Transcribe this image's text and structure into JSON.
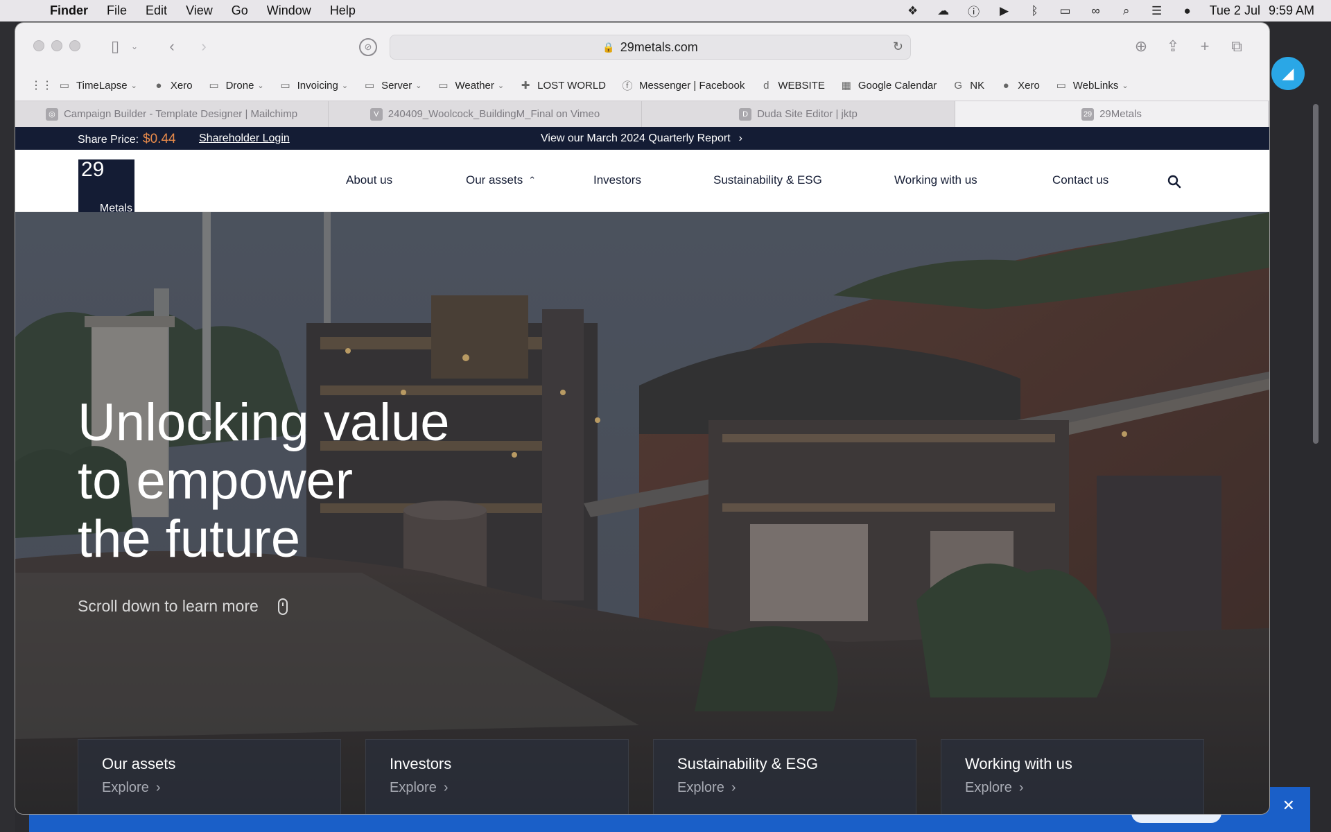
{
  "menubar": {
    "app": "Finder",
    "items": [
      "File",
      "Edit",
      "View",
      "Go",
      "Window",
      "Help"
    ],
    "date": "Tue 2 Jul",
    "time": "9:59 AM",
    "icons": [
      "dropbox-icon",
      "creative-cloud-icon",
      "onepassword-icon",
      "play-icon",
      "bluetooth-icon",
      "battery-icon",
      "link-icon",
      "spotlight-icon",
      "control-center-icon",
      "siri-icon"
    ]
  },
  "browser": {
    "url": "29metals.com",
    "bookmarks": [
      {
        "label": "TimeLapse",
        "icon": "folder-icon",
        "chevron": true
      },
      {
        "label": "Xero",
        "icon": "xero-icon",
        "chevron": false
      },
      {
        "label": "Drone",
        "icon": "folder-icon",
        "chevron": true
      },
      {
        "label": "Invoicing",
        "icon": "folder-icon",
        "chevron": true
      },
      {
        "label": "Server",
        "icon": "folder-icon",
        "chevron": true
      },
      {
        "label": "Weather",
        "icon": "folder-icon",
        "chevron": true
      },
      {
        "label": "LOST WORLD",
        "icon": "plus-icon",
        "chevron": false
      },
      {
        "label": "Messenger | Facebook",
        "icon": "facebook-icon",
        "chevron": false
      },
      {
        "label": "WEBSITE",
        "icon": "duda-icon",
        "chevron": false
      },
      {
        "label": "Google Calendar",
        "icon": "calendar-icon",
        "chevron": false
      },
      {
        "label": "NK",
        "icon": "google-icon",
        "chevron": false
      },
      {
        "label": "Xero",
        "icon": "xero-icon",
        "chevron": false
      },
      {
        "label": "WebLinks",
        "icon": "folder-icon",
        "chevron": true
      }
    ],
    "tabs": [
      {
        "label": "Campaign Builder - Template Designer | Mailchimp",
        "icon": "mailchimp-icon",
        "active": false
      },
      {
        "label": "240409_Woolcock_BuildingM_Final on Vimeo",
        "icon": "vimeo-icon",
        "active": false
      },
      {
        "label": "Duda Site Editor | jktp",
        "icon": "duda-icon",
        "active": false
      },
      {
        "label": "29Metals",
        "icon": "29metals-icon",
        "active": true
      }
    ]
  },
  "site": {
    "topstrip": {
      "share_label": "Share Price:",
      "share_price": "$0.44",
      "login": "Shareholder Login",
      "report": "View our March 2024 Quarterly Report",
      "report_arrow": "›"
    },
    "logo": {
      "number": "29",
      "word": "Metals"
    },
    "nav": [
      {
        "label": "About us"
      },
      {
        "label": "Our assets",
        "expanded": true
      },
      {
        "label": "Investors"
      },
      {
        "label": "Sustainability & ESG"
      },
      {
        "label": "Working with us"
      },
      {
        "label": "Contact us"
      }
    ],
    "hero": {
      "title_lines": [
        "Unlocking value",
        "to empower",
        "the future"
      ],
      "scroll_hint": "Scroll down to learn more"
    },
    "cards": [
      {
        "title": "Our assets",
        "cta": "Explore"
      },
      {
        "title": "Investors",
        "cta": "Explore"
      },
      {
        "title": "Sustainability & ESG",
        "cta": "Explore"
      },
      {
        "title": "Working with us",
        "cta": "Explore"
      }
    ]
  },
  "colors": {
    "navy": "#141c34",
    "share_price": "#e88a4a",
    "banner_blue": "#1a5fc8"
  }
}
